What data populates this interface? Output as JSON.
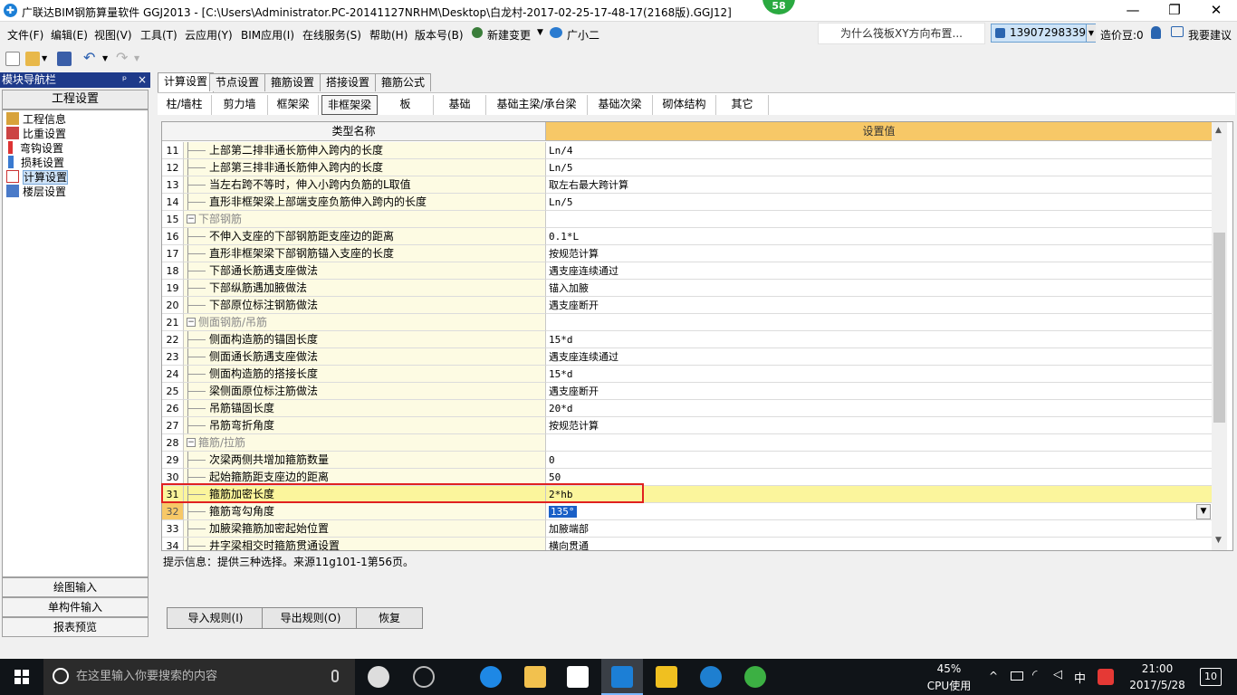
{
  "window": {
    "title": "广联达BIM钢筋算量软件 GGJ2013 - [C:\\Users\\Administrator.PC-20141127NRHM\\Desktop\\白龙村-2017-02-25-17-48-17(2168版).GGJ12]",
    "badge": "58",
    "min_glyph": "—",
    "max_glyph": "❐",
    "close_glyph": "✕"
  },
  "menu": {
    "items": [
      "文件(F)",
      "编辑(E)",
      "视图(V)",
      "工具(T)",
      "云应用(Y)",
      "BIM应用(I)",
      "在线服务(S)",
      "帮助(H)",
      "版本号(B)",
      "新建变更",
      "广小二"
    ],
    "question": "为什么筏板XY方向布置...",
    "user": "13907298339",
    "cost_beans": "造价豆:0",
    "suggest": "我要建议"
  },
  "nav": {
    "header": "模块导航栏",
    "pin": "ᵖ",
    "close": "×",
    "section": "工程设置",
    "items": [
      "工程信息",
      "比重设置",
      "弯钩设置",
      "损耗设置",
      "计算设置",
      "楼层设置"
    ],
    "bottom_buttons": [
      "绘图输入",
      "单构件输入",
      "报表预览"
    ]
  },
  "tabs": [
    "计算设置",
    "节点设置",
    "箍筋设置",
    "搭接设置",
    "箍筋公式"
  ],
  "subtabs": [
    "柱/墙柱",
    "剪力墙",
    "框架梁",
    "非框架梁",
    "板",
    "基础",
    "基础主梁/承台梁",
    "基础次梁",
    "砌体结构",
    "其它"
  ],
  "grid": {
    "col_name": "类型名称",
    "col_value": "设置值",
    "rows": [
      {
        "n": "11",
        "name": "上部第二排非通长筋伸入跨内的长度",
        "value": "Ln/4"
      },
      {
        "n": "12",
        "name": "上部第三排非通长筋伸入跨内的长度",
        "value": "Ln/5"
      },
      {
        "n": "13",
        "name": "当左右跨不等时，伸入小跨内负筋的L取值",
        "value": "取左右最大跨计算"
      },
      {
        "n": "14",
        "name": "直形非框架梁上部端支座负筋伸入跨内的长度",
        "value": "Ln/5"
      },
      {
        "n": "15",
        "name": "下部钢筋",
        "value": "",
        "group": true
      },
      {
        "n": "16",
        "name": "不伸入支座的下部钢筋距支座边的距离",
        "value": "0.1*L"
      },
      {
        "n": "17",
        "name": "直形非框架梁下部钢筋锚入支座的长度",
        "value": "按规范计算"
      },
      {
        "n": "18",
        "name": "下部通长筋遇支座做法",
        "value": "遇支座连续通过"
      },
      {
        "n": "19",
        "name": "下部纵筋遇加腋做法",
        "value": "锚入加腋"
      },
      {
        "n": "20",
        "name": "下部原位标注钢筋做法",
        "value": "遇支座断开"
      },
      {
        "n": "21",
        "name": "侧面钢筋/吊筋",
        "value": "",
        "group": true
      },
      {
        "n": "22",
        "name": "侧面构造筋的锚固长度",
        "value": "15*d"
      },
      {
        "n": "23",
        "name": "侧面通长筋遇支座做法",
        "value": "遇支座连续通过"
      },
      {
        "n": "24",
        "name": "侧面构造筋的搭接长度",
        "value": "15*d"
      },
      {
        "n": "25",
        "name": "梁侧面原位标注筋做法",
        "value": "遇支座断开"
      },
      {
        "n": "26",
        "name": "吊筋锚固长度",
        "value": "20*d"
      },
      {
        "n": "27",
        "name": "吊筋弯折角度",
        "value": "按规范计算"
      },
      {
        "n": "28",
        "name": "箍筋/拉筋",
        "value": "",
        "group": true
      },
      {
        "n": "29",
        "name": "次梁两侧共增加箍筋数量",
        "value": "0"
      },
      {
        "n": "30",
        "name": "起始箍筋距支座边的距离",
        "value": "50"
      },
      {
        "n": "31",
        "name": "箍筋加密长度",
        "value": "2*hb",
        "highlight": true
      },
      {
        "n": "32",
        "name": "箍筋弯勾角度",
        "value": "135°",
        "current": true
      },
      {
        "n": "33",
        "name": "加腋梁箍筋加密起始位置",
        "value": "加腋端部"
      },
      {
        "n": "34",
        "name": "井字梁相交时箍筋贯通设置",
        "value": "横向贯通"
      }
    ]
  },
  "tip": "提示信息：提供三种选择。来源11g101-1第56页。",
  "actions": [
    "导入规则(I)",
    "导出规则(O)",
    "恢复"
  ],
  "taskbar": {
    "search_placeholder": "在这里输入你要搜索的内容",
    "cpu_percent": "45%",
    "cpu_label": "CPU使用",
    "ime": "中",
    "time": "21:00",
    "date": "2017/5/28",
    "notifications": "10"
  },
  "colors": {
    "header_value_bg": "#f7c867",
    "name_col_bg": "#fdfbe3",
    "highlight_row": "#fbf59c",
    "redbox": "#e02020",
    "nav_header": "#1e3a8a"
  }
}
